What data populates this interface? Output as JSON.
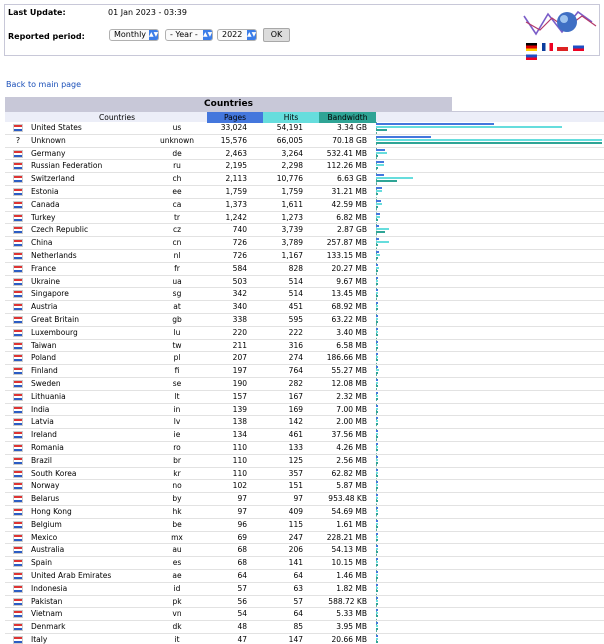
{
  "header": {
    "last_update_label": "Last Update:",
    "last_update_value": "01 Jan 2023 - 03:39",
    "reported_period_label": "Reported period:",
    "period_select": "Monthly",
    "year_placeholder_select": "- Year -",
    "year_select": "2022",
    "ok_label": "OK"
  },
  "back_link": "Back to main page",
  "table": {
    "title": "Countries",
    "columns": [
      "Countries",
      "Pages",
      "Hits",
      "Bandwidth"
    ],
    "colors": {
      "pages": "#4477dd",
      "hits": "#66dddd",
      "bandwidth": "#2ea495",
      "title_bg": "#c8c8d8"
    },
    "rows": [
      {
        "country": "United States",
        "code": "us",
        "pages": "33,024",
        "hits": "54,191",
        "bandwidth": "3.34 GB",
        "p": 33024,
        "h": 54191,
        "b": 3.34,
        "flag": "us-flag-icon"
      },
      {
        "country": "Unknown",
        "code": "unknown",
        "pages": "15,576",
        "hits": "66,005",
        "bandwidth": "70.18 GB",
        "p": 15576,
        "h": 66005,
        "b": 70.18,
        "flag": "unknown-flag-icon"
      },
      {
        "country": "Germany",
        "code": "de",
        "pages": "2,463",
        "hits": "3,264",
        "bandwidth": "532.41 MB",
        "p": 2463,
        "h": 3264,
        "b": 0.532,
        "flag": "de-flag-icon"
      },
      {
        "country": "Russian Federation",
        "code": "ru",
        "pages": "2,195",
        "hits": "2,298",
        "bandwidth": "112.26 MB",
        "p": 2195,
        "h": 2298,
        "b": 0.112,
        "flag": "ru-flag-icon"
      },
      {
        "country": "Switzerland",
        "code": "ch",
        "pages": "2,113",
        "hits": "10,776",
        "bandwidth": "6.63 GB",
        "p": 2113,
        "h": 10776,
        "b": 6.63,
        "flag": "ch-flag-icon"
      },
      {
        "country": "Estonia",
        "code": "ee",
        "pages": "1,759",
        "hits": "1,759",
        "bandwidth": "31.21 MB",
        "p": 1759,
        "h": 1759,
        "b": 0.031,
        "flag": "ee-flag-icon"
      },
      {
        "country": "Canada",
        "code": "ca",
        "pages": "1,373",
        "hits": "1,611",
        "bandwidth": "42.59 MB",
        "p": 1373,
        "h": 1611,
        "b": 0.043,
        "flag": "ca-flag-icon"
      },
      {
        "country": "Turkey",
        "code": "tr",
        "pages": "1,242",
        "hits": "1,273",
        "bandwidth": "6.82 MB",
        "p": 1242,
        "h": 1273,
        "b": 0.007,
        "flag": "tr-flag-icon"
      },
      {
        "country": "Czech Republic",
        "code": "cz",
        "pages": "740",
        "hits": "3,739",
        "bandwidth": "2.87 GB",
        "p": 740,
        "h": 3739,
        "b": 2.87,
        "flag": "cz-flag-icon"
      },
      {
        "country": "China",
        "code": "cn",
        "pages": "726",
        "hits": "3,789",
        "bandwidth": "257.87 MB",
        "p": 726,
        "h": 3789,
        "b": 0.258,
        "flag": "cn-flag-icon"
      },
      {
        "country": "Netherlands",
        "code": "nl",
        "pages": "726",
        "hits": "1,167",
        "bandwidth": "133.15 MB",
        "p": 726,
        "h": 1167,
        "b": 0.133,
        "flag": "nl-flag-icon"
      },
      {
        "country": "France",
        "code": "fr",
        "pages": "584",
        "hits": "828",
        "bandwidth": "20.27 MB",
        "p": 584,
        "h": 828,
        "b": 0.02,
        "flag": "fr-flag-icon"
      },
      {
        "country": "Ukraine",
        "code": "ua",
        "pages": "503",
        "hits": "514",
        "bandwidth": "9.67 MB",
        "p": 503,
        "h": 514,
        "b": 0.01,
        "flag": "ua-flag-icon"
      },
      {
        "country": "Singapore",
        "code": "sg",
        "pages": "342",
        "hits": "514",
        "bandwidth": "13.45 MB",
        "p": 342,
        "h": 514,
        "b": 0.013,
        "flag": "sg-flag-icon"
      },
      {
        "country": "Austria",
        "code": "at",
        "pages": "340",
        "hits": "451",
        "bandwidth": "68.92 MB",
        "p": 340,
        "h": 451,
        "b": 0.069,
        "flag": "at-flag-icon"
      },
      {
        "country": "Great Britain",
        "code": "gb",
        "pages": "338",
        "hits": "595",
        "bandwidth": "63.22 MB",
        "p": 338,
        "h": 595,
        "b": 0.063,
        "flag": "gb-flag-icon"
      },
      {
        "country": "Luxembourg",
        "code": "lu",
        "pages": "220",
        "hits": "222",
        "bandwidth": "3.40 MB",
        "p": 220,
        "h": 222,
        "b": 0.003,
        "flag": "lu-flag-icon"
      },
      {
        "country": "Taiwan",
        "code": "tw",
        "pages": "211",
        "hits": "316",
        "bandwidth": "6.58 MB",
        "p": 211,
        "h": 316,
        "b": 0.007,
        "flag": "tw-flag-icon"
      },
      {
        "country": "Poland",
        "code": "pl",
        "pages": "207",
        "hits": "274",
        "bandwidth": "186.66 MB",
        "p": 207,
        "h": 274,
        "b": 0.187,
        "flag": "pl-flag-icon"
      },
      {
        "country": "Finland",
        "code": "fi",
        "pages": "197",
        "hits": "764",
        "bandwidth": "55.27 MB",
        "p": 197,
        "h": 764,
        "b": 0.055,
        "flag": "fi-flag-icon"
      },
      {
        "country": "Sweden",
        "code": "se",
        "pages": "190",
        "hits": "282",
        "bandwidth": "12.08 MB",
        "p": 190,
        "h": 282,
        "b": 0.012,
        "flag": "se-flag-icon"
      },
      {
        "country": "Lithuania",
        "code": "lt",
        "pages": "157",
        "hits": "167",
        "bandwidth": "2.32 MB",
        "p": 157,
        "h": 167,
        "b": 0.002,
        "flag": "lt-flag-icon"
      },
      {
        "country": "India",
        "code": "in",
        "pages": "139",
        "hits": "169",
        "bandwidth": "7.00 MB",
        "p": 139,
        "h": 169,
        "b": 0.007,
        "flag": "in-flag-icon"
      },
      {
        "country": "Latvia",
        "code": "lv",
        "pages": "138",
        "hits": "142",
        "bandwidth": "2.00 MB",
        "p": 138,
        "h": 142,
        "b": 0.002,
        "flag": "lv-flag-icon"
      },
      {
        "country": "Ireland",
        "code": "ie",
        "pages": "134",
        "hits": "461",
        "bandwidth": "37.56 MB",
        "p": 134,
        "h": 461,
        "b": 0.038,
        "flag": "ie-flag-icon"
      },
      {
        "country": "Romania",
        "code": "ro",
        "pages": "110",
        "hits": "133",
        "bandwidth": "4.26 MB",
        "p": 110,
        "h": 133,
        "b": 0.004,
        "flag": "ro-flag-icon"
      },
      {
        "country": "Brazil",
        "code": "br",
        "pages": "110",
        "hits": "125",
        "bandwidth": "2.56 MB",
        "p": 110,
        "h": 125,
        "b": 0.003,
        "flag": "br-flag-icon"
      },
      {
        "country": "South Korea",
        "code": "kr",
        "pages": "110",
        "hits": "357",
        "bandwidth": "62.82 MB",
        "p": 110,
        "h": 357,
        "b": 0.063,
        "flag": "kr-flag-icon"
      },
      {
        "country": "Norway",
        "code": "no",
        "pages": "102",
        "hits": "151",
        "bandwidth": "5.87 MB",
        "p": 102,
        "h": 151,
        "b": 0.006,
        "flag": "no-flag-icon"
      },
      {
        "country": "Belarus",
        "code": "by",
        "pages": "97",
        "hits": "97",
        "bandwidth": "953.48 KB",
        "p": 97,
        "h": 97,
        "b": 0.001,
        "flag": "by-flag-icon"
      },
      {
        "country": "Hong Kong",
        "code": "hk",
        "pages": "97",
        "hits": "409",
        "bandwidth": "54.69 MB",
        "p": 97,
        "h": 409,
        "b": 0.055,
        "flag": "hk-flag-icon"
      },
      {
        "country": "Belgium",
        "code": "be",
        "pages": "96",
        "hits": "115",
        "bandwidth": "1.61 MB",
        "p": 96,
        "h": 115,
        "b": 0.002,
        "flag": "be-flag-icon"
      },
      {
        "country": "Mexico",
        "code": "mx",
        "pages": "69",
        "hits": "247",
        "bandwidth": "228.21 MB",
        "p": 69,
        "h": 247,
        "b": 0.228,
        "flag": "mx-flag-icon"
      },
      {
        "country": "Australia",
        "code": "au",
        "pages": "68",
        "hits": "206",
        "bandwidth": "54.13 MB",
        "p": 68,
        "h": 206,
        "b": 0.054,
        "flag": "au-flag-icon"
      },
      {
        "country": "Spain",
        "code": "es",
        "pages": "68",
        "hits": "141",
        "bandwidth": "10.15 MB",
        "p": 68,
        "h": 141,
        "b": 0.01,
        "flag": "es-flag-icon"
      },
      {
        "country": "United Arab Emirates",
        "code": "ae",
        "pages": "64",
        "hits": "64",
        "bandwidth": "1.46 MB",
        "p": 64,
        "h": 64,
        "b": 0.001,
        "flag": "ae-flag-icon"
      },
      {
        "country": "Indonesia",
        "code": "id",
        "pages": "57",
        "hits": "63",
        "bandwidth": "1.82 MB",
        "p": 57,
        "h": 63,
        "b": 0.002,
        "flag": "id-flag-icon"
      },
      {
        "country": "Pakistan",
        "code": "pk",
        "pages": "56",
        "hits": "57",
        "bandwidth": "588.72 KB",
        "p": 56,
        "h": 57,
        "b": 0.001,
        "flag": "pk-flag-icon"
      },
      {
        "country": "Vietnam",
        "code": "vn",
        "pages": "54",
        "hits": "64",
        "bandwidth": "5.33 MB",
        "p": 54,
        "h": 64,
        "b": 0.005,
        "flag": "vn-flag-icon"
      },
      {
        "country": "Denmark",
        "code": "dk",
        "pages": "48",
        "hits": "85",
        "bandwidth": "3.95 MB",
        "p": 48,
        "h": 85,
        "b": 0.004,
        "flag": "dk-flag-icon"
      },
      {
        "country": "Italy",
        "code": "it",
        "pages": "47",
        "hits": "147",
        "bandwidth": "20.66 MB",
        "p": 47,
        "h": 147,
        "b": 0.021,
        "flag": "it-flag-icon"
      }
    ]
  }
}
